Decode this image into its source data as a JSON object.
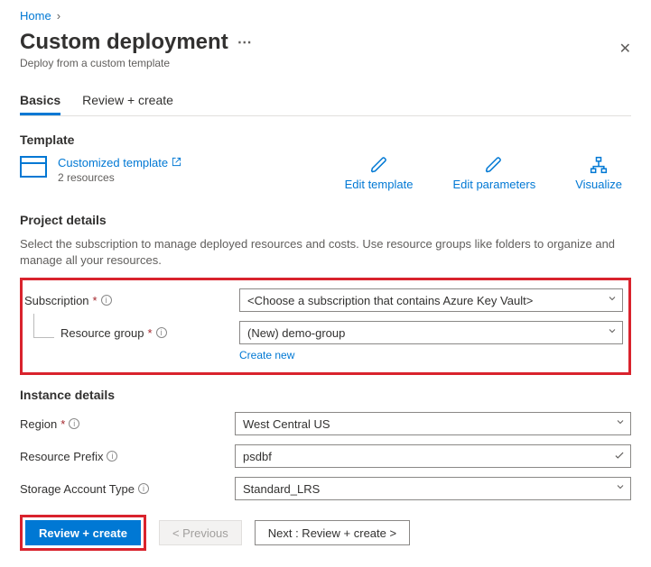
{
  "breadcrumb": {
    "home": "Home"
  },
  "header": {
    "title": "Custom deployment",
    "subtitle": "Deploy from a custom template"
  },
  "tabs": {
    "basics": "Basics",
    "review": "Review + create"
  },
  "template": {
    "section_label": "Template",
    "name": "Customized template",
    "resources": "2 resources",
    "actions": {
      "edit_template": "Edit template",
      "edit_parameters": "Edit parameters",
      "visualize": "Visualize"
    }
  },
  "project": {
    "section_label": "Project details",
    "description": "Select the subscription to manage deployed resources and costs. Use resource groups like folders to organize and manage all your resources.",
    "subscription_label": "Subscription",
    "subscription_value": "<Choose a subscription that contains Azure Key Vault>",
    "rg_label": "Resource group",
    "rg_value": "(New) demo-group",
    "create_new": "Create new"
  },
  "instance": {
    "section_label": "Instance details",
    "region_label": "Region",
    "region_value": "West Central US",
    "prefix_label": "Resource Prefix",
    "prefix_value": "psdbf",
    "storage_label": "Storage Account Type",
    "storage_value": "Standard_LRS"
  },
  "footer": {
    "review_create": "Review + create",
    "previous": "< Previous",
    "next": "Next : Review + create >"
  }
}
